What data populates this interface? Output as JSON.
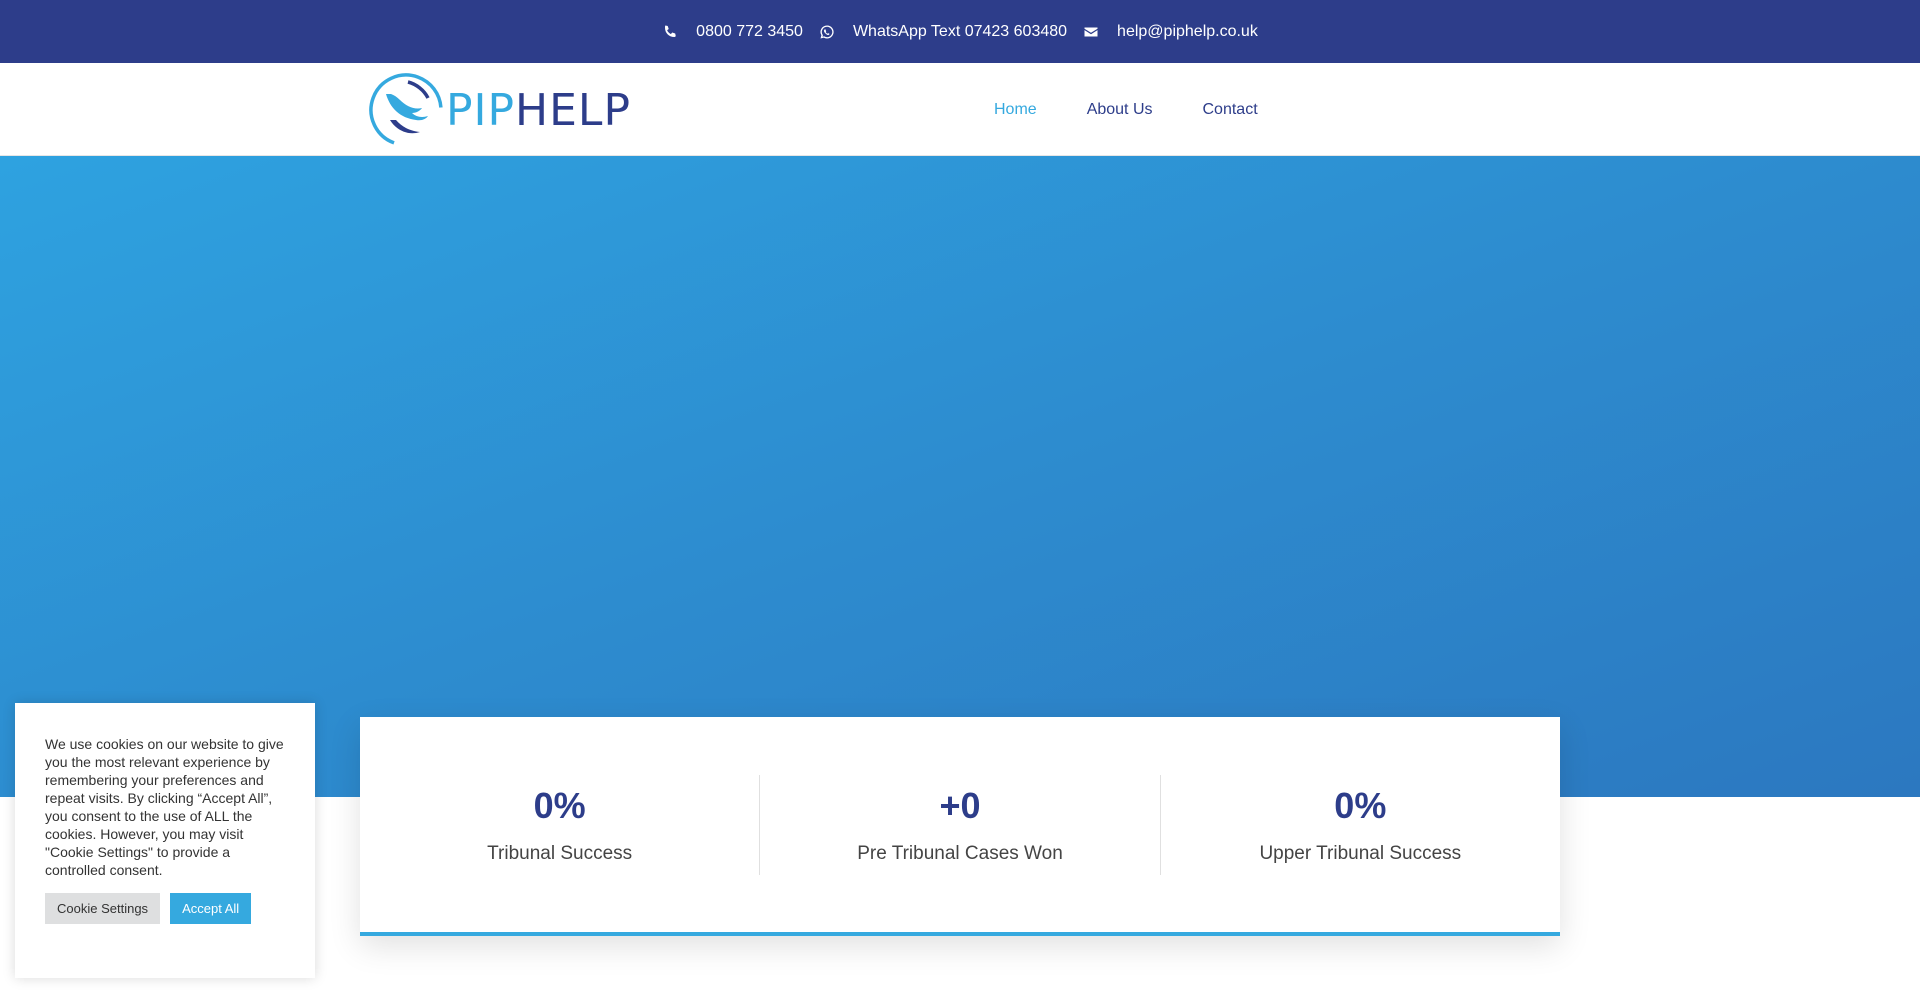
{
  "topbar": {
    "phone": "0800 772 3450",
    "whatsapp": "WhatsApp Text 07423 603480",
    "email": "help@piphelp.co.uk",
    "phone_icon": "phone-icon",
    "whatsapp_icon": "whatsapp-icon",
    "email_icon": "envelope-icon"
  },
  "logo": {
    "part1": "PIP",
    "part2": "HELP",
    "icon": "helping-hands-icon"
  },
  "nav": {
    "items": [
      {
        "label": "Home"
      },
      {
        "label": "About Us"
      },
      {
        "label": "Contact"
      }
    ],
    "active": "Home"
  },
  "stats": [
    {
      "value": "0%",
      "label": "Tribunal Success"
    },
    {
      "value": "+0",
      "label": "Pre Tribunal Cases Won"
    },
    {
      "value": "0%",
      "label": "Upper Tribunal Success"
    }
  ],
  "cookie": {
    "text": "We use cookies on our website to give you the most relevant experience by remembering your preferences and repeat visits. By clicking “Accept All”, you consent to the use of ALL the cookies. However, you may visit \"Cookie Settings\" to provide a controlled consent.",
    "settings_label": "Cookie Settings",
    "accept_label": "Accept All"
  },
  "colors": {
    "navy": "#2d3d8a",
    "accent": "#35a9df",
    "hero": "#2d8ccf"
  }
}
